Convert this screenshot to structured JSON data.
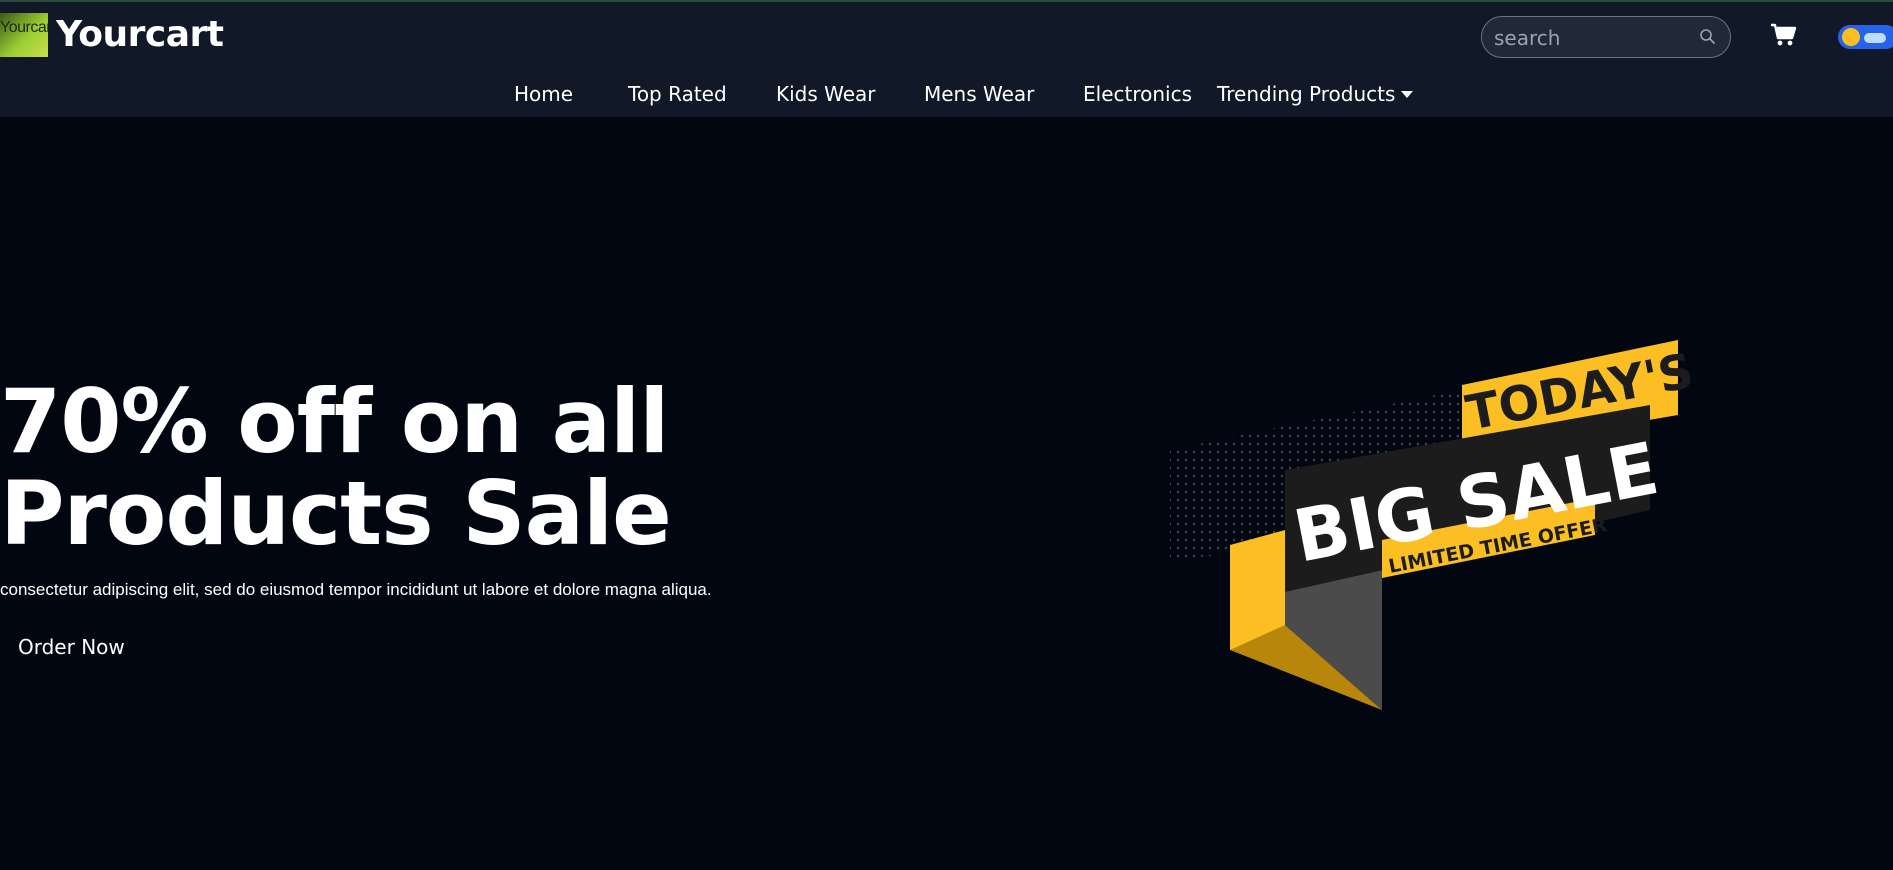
{
  "header": {
    "logo_text": "Yourcart",
    "brand": "Yourcart",
    "search": {
      "placeholder": "search"
    },
    "cart_icon": "cart-icon",
    "theme_toggle": "theme-toggle"
  },
  "nav": {
    "items": [
      {
        "label": "Home"
      },
      {
        "label": "Top Rated"
      },
      {
        "label": "Kids Wear"
      },
      {
        "label": "Mens Wear"
      },
      {
        "label": "Electronics"
      },
      {
        "label": "Trending Products"
      }
    ]
  },
  "hero": {
    "title_line1": "70% off on all",
    "title_line2": "Products Sale",
    "subtitle": "consectetur adipiscing elit, sed do eiusmod tempor incididunt ut labore et dolore magna aliqua.",
    "cta": "Order Now",
    "banner": {
      "line1": "TODAY'S",
      "line2": "BIG SALE",
      "line3": "LIMITED TIME OFFER"
    }
  },
  "colors": {
    "background": "#020611",
    "header": "#111827",
    "accent_yellow": "#fbbf24",
    "banner_dark": "#1c1c1c"
  }
}
